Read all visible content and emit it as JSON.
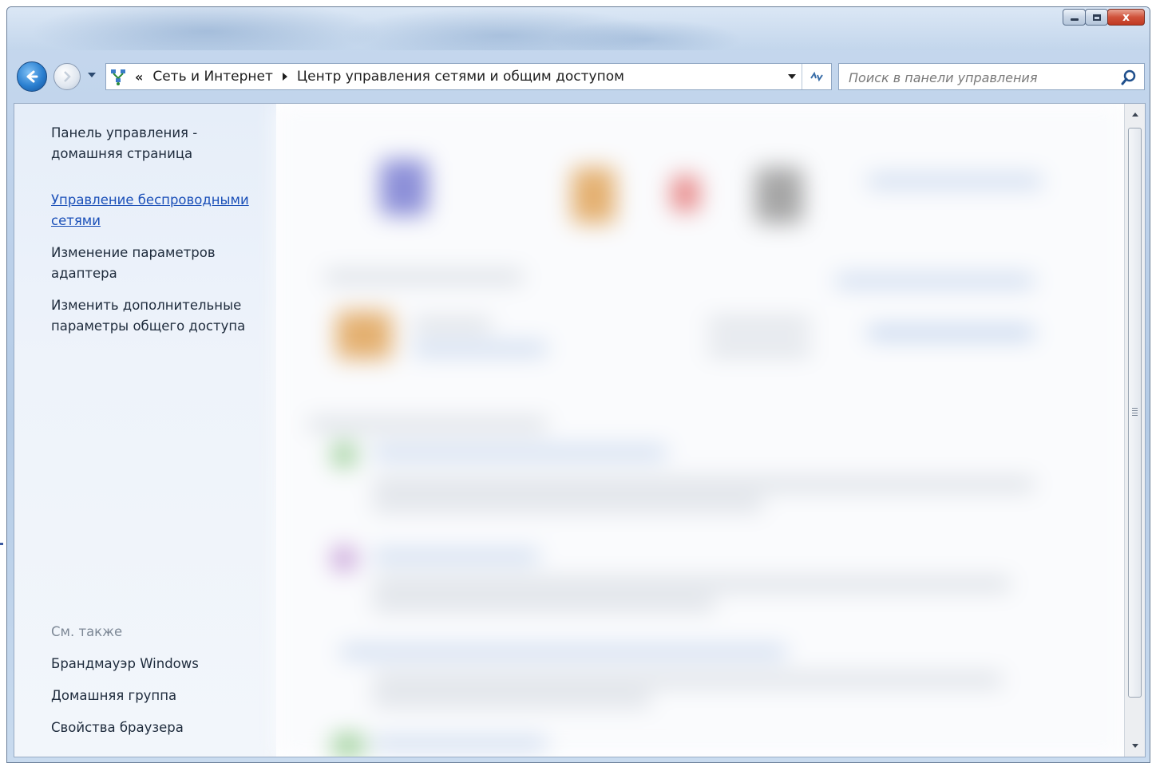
{
  "window": {
    "controls": {
      "minimize_icon": "minimize-icon",
      "maximize_icon": "maximize-icon",
      "close_glyph": "x"
    }
  },
  "nav": {
    "back_icon": "back-arrow-icon",
    "forward_icon": "forward-arrow-icon",
    "breadcrumb": {
      "overflow": "«",
      "items": [
        "Сеть и Интернет",
        "Центр управления сетями и общим доступом"
      ]
    },
    "search_placeholder": "Поиск в панели управления",
    "refresh_icon": "refresh-icon"
  },
  "sidebar": {
    "home_link": "Панель управления - домашняя страница",
    "tasks": [
      "Управление беспроводными сетями",
      "Изменение параметров адаптера",
      "Изменить дополнительные параметры общего доступа"
    ],
    "see_also_label": "См. также",
    "see_also": [
      "Брандмауэр Windows",
      "Домашняя группа",
      "Свойства браузера"
    ]
  },
  "colors": {
    "link_active": "#1a4fb8",
    "sidebar_text": "#1e2b3c",
    "muted_text": "#7d8896",
    "chrome": "#c3d6ec"
  }
}
